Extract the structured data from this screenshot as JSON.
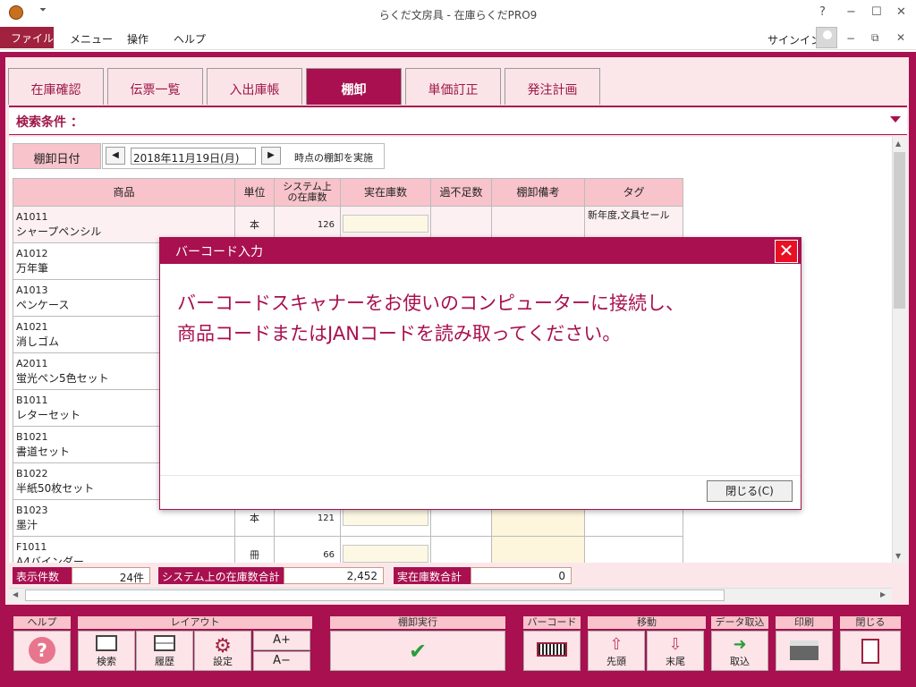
{
  "window": {
    "title": "らくだ文房具 - 在庫らくだPRO9",
    "help_glyph": "?",
    "minimize_glyph": "−",
    "maximize_glyph": "☐",
    "close_glyph": "✕"
  },
  "menubar": {
    "file": "ファイル",
    "items": [
      "メニュー",
      "操作",
      "ヘルプ"
    ],
    "signin": "サインイン"
  },
  "tabs": [
    "在庫確認",
    "伝票一覧",
    "入出庫帳",
    "棚卸",
    "単価訂正",
    "発注計画"
  ],
  "active_tab": 3,
  "search": {
    "label": "検索条件 ："
  },
  "date_row": {
    "label": "棚卸日付",
    "prev": "◀",
    "next": "▶",
    "value": "2018年11月19日(月)",
    "suffix": "時点の棚卸を実施"
  },
  "table": {
    "headers": [
      "商品",
      "単位",
      "システム上の在庫数",
      "実在庫数",
      "過不足数",
      "棚卸備考",
      "タグ"
    ],
    "rows": [
      {
        "code": "A1011",
        "name": "シャープペンシル",
        "unit": "本",
        "qty": "126",
        "tag": "新年度,文具セール"
      },
      {
        "code": "A1012",
        "name": "万年筆",
        "unit": "",
        "qty": "",
        "tag": ""
      },
      {
        "code": "A1013",
        "name": "ペンケース",
        "unit": "",
        "qty": "",
        "tag": ""
      },
      {
        "code": "A1021",
        "name": "消しゴム",
        "unit": "",
        "qty": "",
        "tag": ""
      },
      {
        "code": "A2011",
        "name": "蛍光ペン5色セット",
        "unit": "",
        "qty": "",
        "tag": ""
      },
      {
        "code": "B1011",
        "name": "レターセット",
        "unit": "",
        "qty": "",
        "tag": ""
      },
      {
        "code": "B1021",
        "name": "書道セット",
        "unit": "",
        "qty": "",
        "tag": ""
      },
      {
        "code": "B1022",
        "name": "半紙50枚セット",
        "unit": "",
        "qty": "",
        "tag": ""
      },
      {
        "code": "B1023",
        "name": "墨汁",
        "unit": "本",
        "qty": "121",
        "tag": ""
      },
      {
        "code": "F1011",
        "name": "A4バインダー",
        "unit": "冊",
        "qty": "66",
        "tag": ""
      }
    ]
  },
  "status": {
    "count_label": "表示件数",
    "count_value": "24件",
    "sys_label": "システム上の在庫数合計",
    "sys_value": "2,452",
    "real_label": "実在庫数合計",
    "real_value": "0"
  },
  "toolbar": {
    "help_group": "ヘルプ",
    "layout_group": "レイアウト",
    "exec_group": "棚卸実行",
    "barcode_group": "バーコード",
    "move_group": "移動",
    "import_group": "データ取込",
    "print_group": "印刷",
    "close_group": "閉じる",
    "search_btn": "検索",
    "history_btn": "履歴",
    "settings_btn": "設定",
    "font_up": "A+",
    "font_down": "A−",
    "first_btn": "先頭",
    "last_btn": "末尾",
    "import_btn": "取込"
  },
  "dialog": {
    "title": "バーコード入力",
    "line1": "バーコードスキャナーをお使いのコンピューターに接続し、",
    "line2": "商品コードまたはJANコードを読み取ってください。",
    "close_button": "閉じる(C)",
    "close_glyph": "✕"
  },
  "colors": {
    "accent": "#a8104f",
    "header": "#f8c3cb",
    "background": "#fbe7ea"
  }
}
